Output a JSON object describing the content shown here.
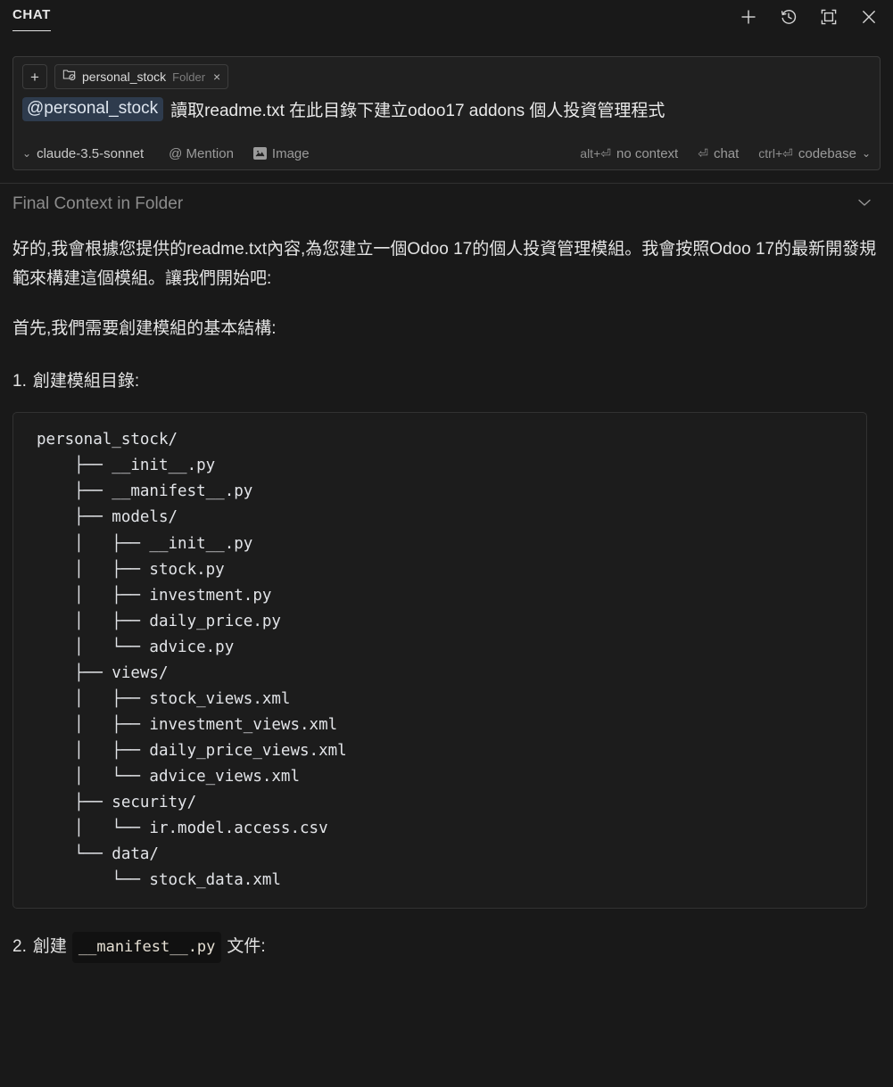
{
  "header": {
    "title": "CHAT",
    "actions": [
      {
        "name": "new-chat-icon",
        "label": "+"
      },
      {
        "name": "history-icon",
        "label": "History"
      },
      {
        "name": "maximize-icon",
        "label": "Maximize"
      },
      {
        "name": "close-icon",
        "label": "Close"
      }
    ]
  },
  "composer": {
    "add_context_label": "+",
    "context_chip": {
      "icon": "folder-check-icon",
      "name": "personal_stock",
      "kind": "Folder",
      "close": "×"
    },
    "prompt": {
      "mention": "@personal_stock",
      "text": "讀取readme.txt 在此目錄下建立odoo17 addons 個人投資管理程式"
    },
    "toolbar": {
      "model": "claude-3.5-sonnet",
      "mention_label": "@ Mention",
      "image_label": "Image",
      "no_context_kbd": "alt+⏎",
      "no_context_label": "no context",
      "chat_kbd": "⏎",
      "chat_label": "chat",
      "codebase_kbd": "ctrl+⏎",
      "codebase_label": "codebase"
    }
  },
  "response": {
    "context_summary_label": "Final Context in Folder",
    "paragraph_1": "好的,我會根據您提供的readme.txt內容,為您建立一個Odoo 17的個人投資管理模組。我會按照Odoo 17的最新開發規範來構建這個模組。讓我們開始吧:",
    "paragraph_2": "首先,我們需要創建模組的基本結構:",
    "list_item_1": {
      "num": "1.",
      "text": "創建模組目錄:"
    },
    "code_tree": "personal_stock/\n    ├── __init__.py\n    ├── __manifest__.py\n    ├── models/\n    │   ├── __init__.py\n    │   ├── stock.py\n    │   ├── investment.py\n    │   ├── daily_price.py\n    │   └── advice.py\n    ├── views/\n    │   ├── stock_views.xml\n    │   ├── investment_views.xml\n    │   ├── daily_price_views.xml\n    │   └── advice_views.xml\n    ├── security/\n    │   └── ir.model.access.csv\n    └── data/\n        └── stock_data.xml",
    "list_item_2": {
      "num": "2.",
      "prefix": "創建",
      "code": "__manifest__.py",
      "suffix": "文件:"
    }
  },
  "colors": {
    "background": "#191919",
    "panel": "#202020",
    "codeblock": "#1c1c1c",
    "mention_pill": "#2e3b4d",
    "text": "#e3e3e3",
    "muted": "#8c8c8c"
  }
}
